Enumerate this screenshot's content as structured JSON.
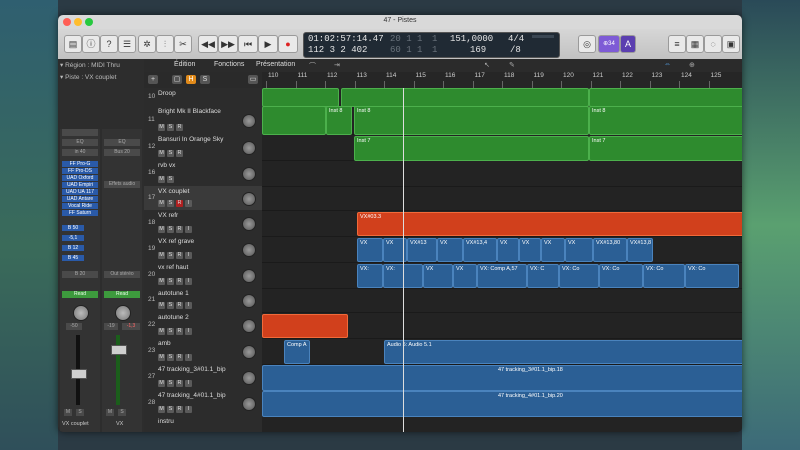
{
  "window_title": "47 - Pistes",
  "lcd": {
    "time": "01:02:57:14.47",
    "bars": "112  3  2  402",
    "col3a": "20  1  1",
    "col3b": "60  1  1",
    "col4a": "1",
    "col4b": "1",
    "tempo": "151,0000",
    "tempo2": "169",
    "sig": "4/4",
    "div": "/8"
  },
  "toolbar": {
    "badge": "⊕34",
    "badge2": "A"
  },
  "inspector": {
    "region_label": "▾ Région : MIDI Thru",
    "track_label": "▾ Piste : VX couplet",
    "in_label": "in 40",
    "bus_label": "Bus 20",
    "plugins": [
      "FF Pro-G",
      "FF Pro-DS",
      "UAD Oxford",
      "UAD Empiri",
      "UAD UA 117",
      "UAD Antare",
      "Vocal Ride",
      "FF Saturn"
    ],
    "sends": [
      "B 50",
      "-5,1",
      "B 12",
      "B 45"
    ],
    "bus_out": "B 20",
    "out_stereo": "Out stéréo",
    "read1": "Read",
    "read2": "Read",
    "fader1_val": "-50",
    "fader2_val": "-19",
    "fader2_peak": "-1,3",
    "strip1_name": "VX couplet",
    "strip2_name": "VX",
    "eq_label": "EQ",
    "eq2_label": "EQ",
    "midi_fx": "Effets audio",
    "ms1": "M",
    "ms2": "S",
    "ms3": "M",
    "ms4": "S"
  },
  "menus": {
    "edition": "Édition",
    "fonctions": "Fonctions",
    "presentation": "Présentation"
  },
  "ruler": [
    "110",
    "111",
    "112",
    "113",
    "114",
    "115",
    "116",
    "117",
    "118",
    "119",
    "120",
    "121",
    "122",
    "123",
    "124",
    "125"
  ],
  "tracks": [
    {
      "num": "10",
      "name": "Droop"
    },
    {
      "num": "11",
      "name": "Bright Mk II Blackface"
    },
    {
      "num": "12",
      "name": "Bansuri In Orange Sky"
    },
    {
      "num": "16",
      "name": "rvb vx"
    },
    {
      "num": "17",
      "name": "VX couplet"
    },
    {
      "num": "18",
      "name": "VX refr"
    },
    {
      "num": "19",
      "name": "VX ref grave"
    },
    {
      "num": "20",
      "name": "vx ref haut"
    },
    {
      "num": "21",
      "name": "autotune 1"
    },
    {
      "num": "22",
      "name": "autotune 2"
    },
    {
      "num": "23",
      "name": "amb"
    },
    {
      "num": "27",
      "name": "47 tracking_3#01.1_bip"
    },
    {
      "num": "28",
      "name": "47 tracking_4#01.1_bip"
    },
    {
      "num": "",
      "name": "instru"
    }
  ],
  "btn": {
    "m": "M",
    "s": "S",
    "r": "R",
    "i": "I",
    "h": "H",
    "plus": "+"
  },
  "regions": {
    "inst8a": "Inst 8",
    "inst8b": "Inst 8",
    "inst7a": "Inst 7",
    "inst7b": "Inst 7",
    "inst8c": "Inst 8",
    "inst8d": "Inst 8",
    "vx_refr": "VX#03.3",
    "vx_grave": [
      "VX",
      "VX",
      "VX#13",
      "VX",
      "VX#13,4",
      "VX",
      "VX",
      "VX",
      "VX",
      "VX#13,80",
      "VX#13,8"
    ],
    "vx_haut": [
      "VX:",
      "VX:",
      "VX",
      "VX",
      "VX: Comp A,57",
      "VX: C",
      "VX: Co",
      "VX: Co",
      "VX: Co",
      "VX: Co"
    ],
    "comp_a": "Comp A",
    "audio5": "Audio 5: Audio 5.1",
    "tracking3": "47 tracking_3#01.1_bip.18",
    "tracking4": "47 tracking_4#01.1_bip.20"
  },
  "colors": {
    "green": "#2e8b2e",
    "orange": "#d1401c",
    "blue": "#2b5f95",
    "purple": "#7e5bd6"
  }
}
